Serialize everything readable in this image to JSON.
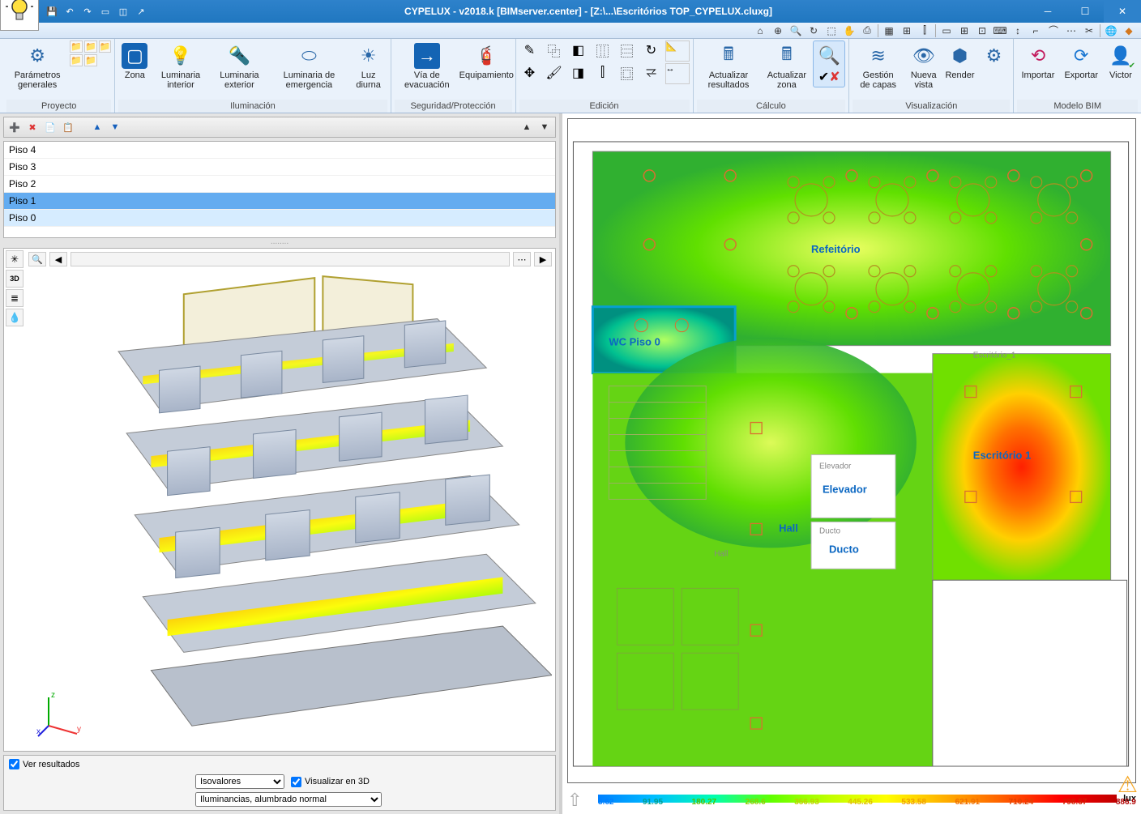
{
  "title": "CYPELUX - v2018.k [BIMserver.center] - [Z:\\...\\Escritórios TOP_CYPELUX.cluxg]",
  "qat": {
    "save": "💾",
    "undo": "↶",
    "redo": "↷",
    "box": "▭",
    "boxes": "◫",
    "exit": "↗"
  },
  "ribbon": {
    "groups": {
      "proyecto": {
        "label": "Proyecto",
        "parametros": "Parámetros\ngenerales"
      },
      "ilum": {
        "label": "Iluminación",
        "zona": "Zona",
        "interior": "Luminaria\ninterior",
        "exterior": "Luminaria\nexterior",
        "emerg": "Luminaria de\nemergencia",
        "diurna": "Luz\ndiurna"
      },
      "seg": {
        "label": "Seguridad/Protección",
        "via": "Vía de\nevacuación",
        "equip": "Equipamiento"
      },
      "edicion": {
        "label": "Edición"
      },
      "calculo": {
        "label": "Cálculo",
        "act_res": "Actualizar\nresultados",
        "act_zona": "Actualizar\nzona"
      },
      "visual": {
        "label": "Visualización",
        "capas": "Gestión\nde capas",
        "vista": "Nueva\nvista",
        "render": "Render"
      },
      "bim": {
        "label": "Modelo BIM",
        "importar": "Importar",
        "exportar": "Exportar",
        "user": "Victor"
      }
    }
  },
  "floors": [
    {
      "name": "Piso 4",
      "sel": false,
      "blue": false
    },
    {
      "name": "Piso 3",
      "sel": false,
      "blue": false
    },
    {
      "name": "Piso 2",
      "sel": false,
      "blue": false
    },
    {
      "name": "Piso 1",
      "sel": false,
      "blue": true
    },
    {
      "name": "Piso 0",
      "sel": true,
      "blue": false
    }
  ],
  "bottom": {
    "ver_result": "Ver resultados",
    "vis3d": "Visualizar en 3D",
    "sel1": "Isovalores",
    "sel2": "Iluminancias, alumbrado normal"
  },
  "plan": {
    "rooms": {
      "refeitorio": "Refeitório",
      "wc": "WC Piso 0",
      "elevador_small": "Elevador",
      "elevador": "Elevador",
      "ducto_small": "Ducto",
      "ducto": "Ducto",
      "hall": "Hall",
      "hall_small": "Hall",
      "esc1": "Escritório 1",
      "esc1_small": "Escritório_1"
    }
  },
  "legend": {
    "values": [
      "3.62",
      "91.95",
      "180.27",
      "268.6",
      "356.93",
      "445.26",
      "533.58",
      "621.91",
      "710.24",
      "798.57",
      "886.9"
    ],
    "unit": "lux"
  }
}
